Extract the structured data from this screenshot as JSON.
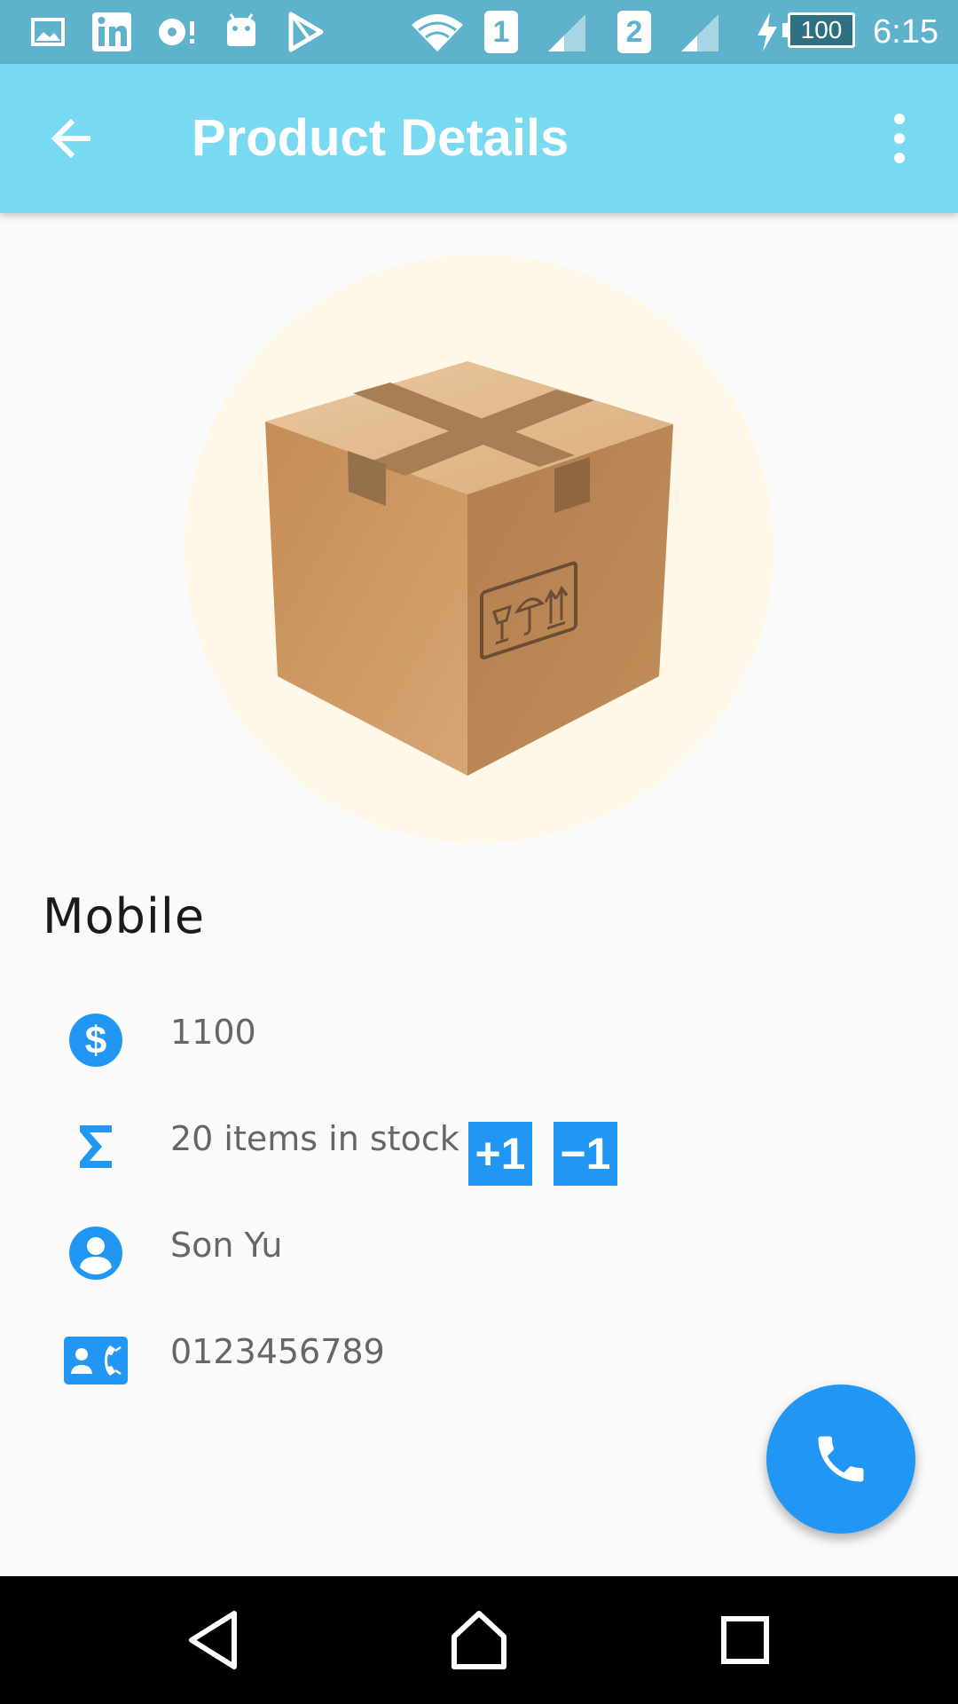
{
  "status_bar": {
    "time": "6:15",
    "battery": "100",
    "sim1_label": "1",
    "sim2_label": "2",
    "icons": [
      "image-icon",
      "linkedin-icon",
      "media-notification-icon",
      "android-icon",
      "play-store-icon",
      "wifi-icon",
      "sim1-icon",
      "signal-icon",
      "sim2-icon",
      "signal-icon",
      "charging-icon",
      "battery-icon"
    ]
  },
  "app_bar": {
    "title": "Product Details",
    "back_icon": "arrow-left-icon",
    "menu_icon": "more-vert-icon",
    "background": "#78d9f0"
  },
  "product": {
    "image_icon": "cardboard-box-icon",
    "name": "Mobile",
    "price": "1100",
    "stock": "20 items in stock",
    "increment_label": "+1",
    "decrement_label": "−1",
    "seller": "Son Yu",
    "phone": "0123456789"
  },
  "icons": {
    "price": "dollar-icon",
    "stock": "sigma-icon",
    "seller": "person-icon",
    "phone": "contact-phone-icon"
  },
  "fab": {
    "icon": "phone-icon",
    "color": "#2196f3"
  },
  "nav_bar": {
    "icons": [
      "back-triangle-icon",
      "home-icon",
      "recents-icon"
    ]
  },
  "colors": {
    "accent": "#2196f3",
    "status_bar": "#5fb2cc",
    "text_secondary": "#666666"
  }
}
